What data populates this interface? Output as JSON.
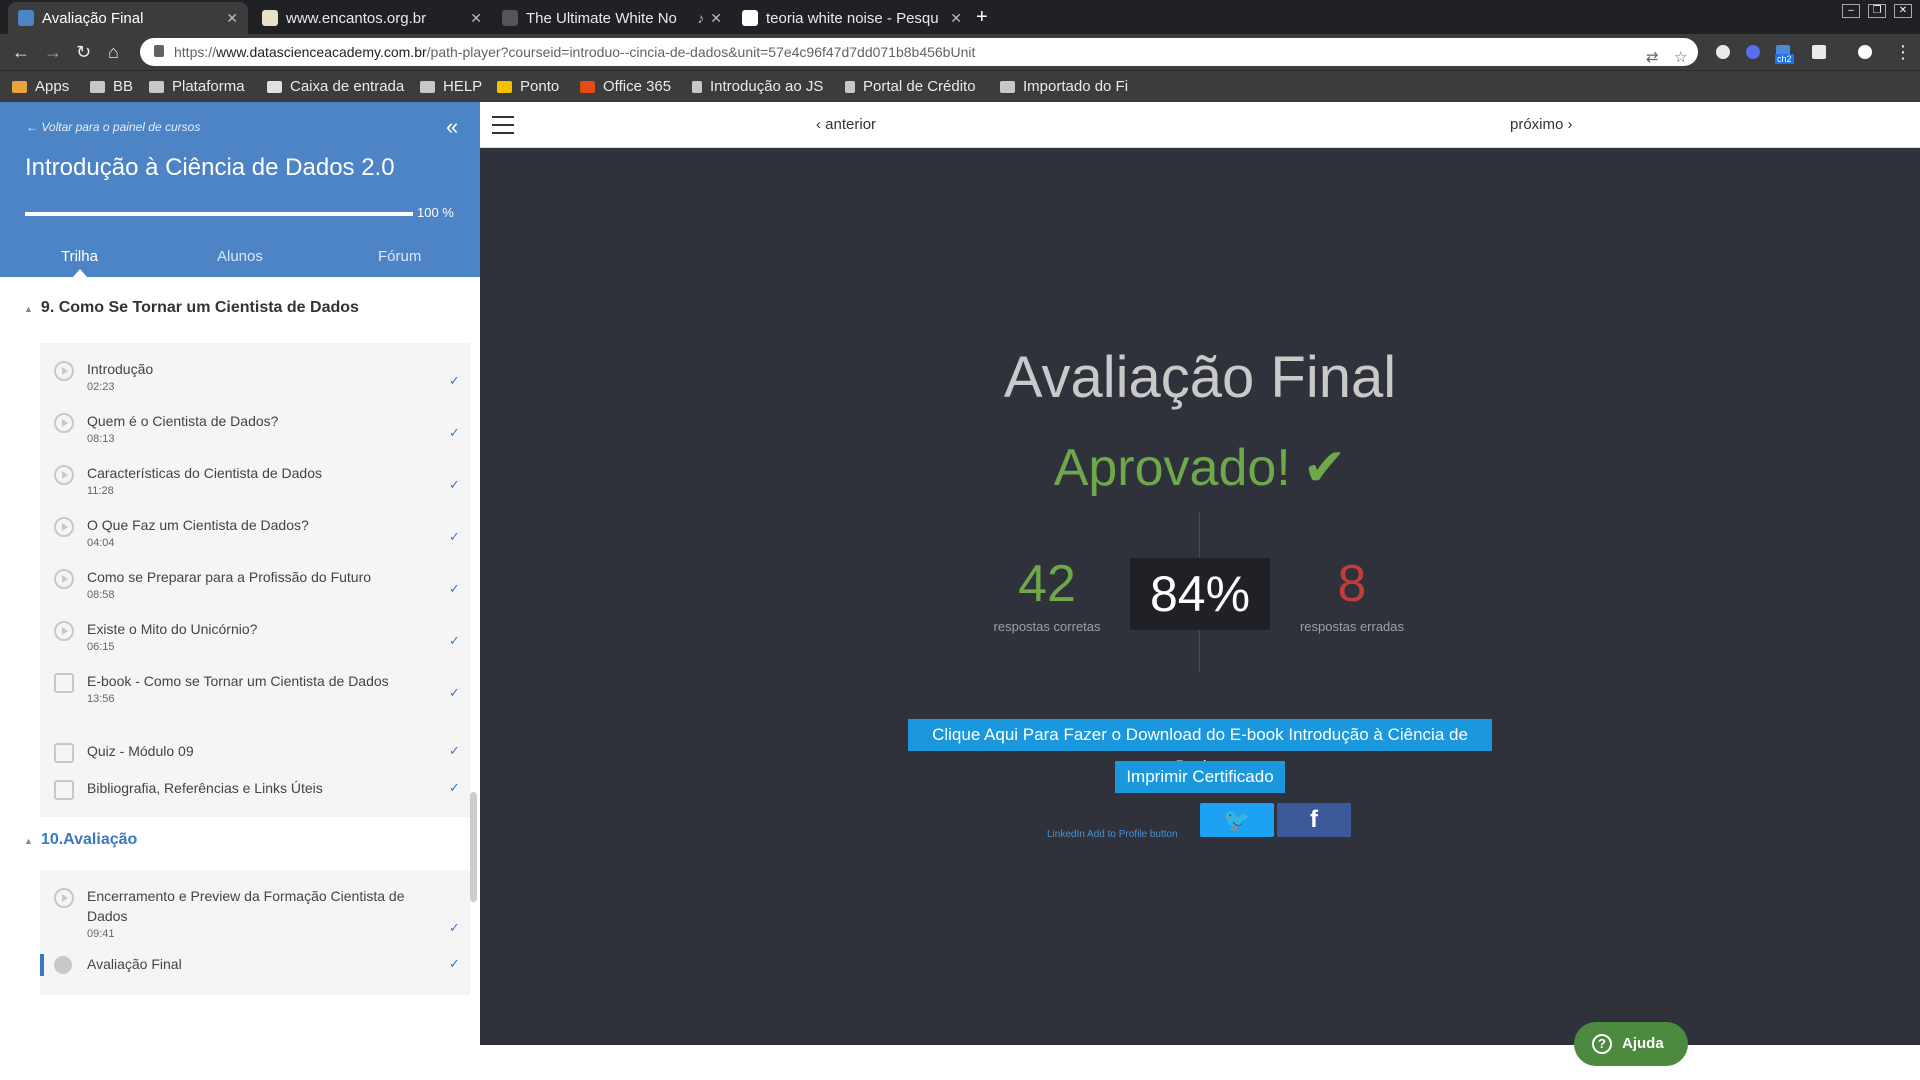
{
  "browser": {
    "tabs": [
      {
        "title": "Avaliação Final",
        "active": true,
        "favicon_color": "#4c84c6"
      },
      {
        "title": "www.encantos.org.br",
        "active": false,
        "favicon_color": "#e8e0c8"
      },
      {
        "title": "The Ultimate White No",
        "active": false,
        "favicon_color": "#555555",
        "audio": true
      },
      {
        "title": "teoria white noise - Pesqu",
        "active": false,
        "favicon_color": "#ffffff"
      }
    ],
    "url_prefix": "https://",
    "url_host": "www.datascienceacademy.com.br",
    "url_path": "/path-player?courseid=introduo--cincia-de-dados&unit=57e4c96f47d7dd071b8b456bUnit",
    "bookmarks": [
      "Apps",
      "BB",
      "Plataforma",
      "Caixa de entrada",
      "HELP",
      "Ponto",
      "Office 365",
      "Introdução ao JS",
      "Portal de Crédito",
      "Importado do Fi"
    ],
    "extension_badge": "ch2"
  },
  "sidebar": {
    "back_link": "← Voltar para o painel de cursos",
    "course_title": "Introdução à Ciência de Dados 2.0",
    "progress": 100,
    "progress_text": "100 %",
    "tabs": [
      "Trilha",
      "Alunos",
      "Fórum"
    ],
    "sections": [
      {
        "title": "9. Como Se Tornar um Cientista de Dados",
        "lessons": [
          {
            "name": "Introdução",
            "duration": "02:23",
            "type": "video",
            "done": true
          },
          {
            "name": "Quem é o Cientista de Dados?",
            "duration": "08:13",
            "type": "video",
            "done": true
          },
          {
            "name": "Características do Cientista de Dados",
            "duration": "11:28",
            "type": "video",
            "done": true
          },
          {
            "name": "O Que Faz um Cientista de Dados?",
            "duration": "04:04",
            "type": "video",
            "done": true
          },
          {
            "name": "Como se Preparar para a Profissão do Futuro",
            "duration": "08:58",
            "type": "video",
            "done": true
          },
          {
            "name": "Existe o Mito do Unicórnio?",
            "duration": "06:15",
            "type": "video",
            "done": true
          },
          {
            "name": "E-book - Como se Tornar um Cientista de Dados",
            "duration": "13:56",
            "type": "book",
            "done": true
          },
          {
            "name": "Quiz - Módulo 09",
            "duration": "",
            "type": "quiz",
            "done": true
          },
          {
            "name": "Bibliografia, Referências e Links Úteis",
            "duration": "",
            "type": "pdf",
            "done": true
          }
        ]
      },
      {
        "title": "10.Avaliação",
        "lessons": [
          {
            "name": "Encerramento e Preview da Formação Cientista de Dados",
            "duration": "09:41",
            "type": "video",
            "done": true
          },
          {
            "name": "Avaliação Final",
            "duration": "",
            "type": "award",
            "done": true,
            "active": true
          }
        ]
      }
    ],
    "check_glyph": "✓"
  },
  "main": {
    "prev_label": "anterior",
    "next_label": "próximo",
    "title": "Avaliação Final",
    "status": "Aprovado!",
    "correct_count": "42",
    "correct_label": "respostas corretas",
    "percent": "84%",
    "wrong_count": "8",
    "wrong_label": "respostas erradas",
    "ebook_button": "Clique Aqui Para Fazer o Download do E-book Introdução à Ciência de Dados",
    "certificate_button": "Imprimir Certificado",
    "linkedin_alt": "LinkedIn Add to Profile button",
    "help_label": "Ajuda"
  },
  "colors": {
    "sidebar_header": "#4c84c6",
    "content_bg": "#2f323b",
    "approved_green": "#6fa84a",
    "wrong_red": "#c33c3c",
    "button_blue": "#1a97dd",
    "twitter": "#1da1f2",
    "facebook": "#3b5998",
    "help_green": "#4c8a3f"
  }
}
